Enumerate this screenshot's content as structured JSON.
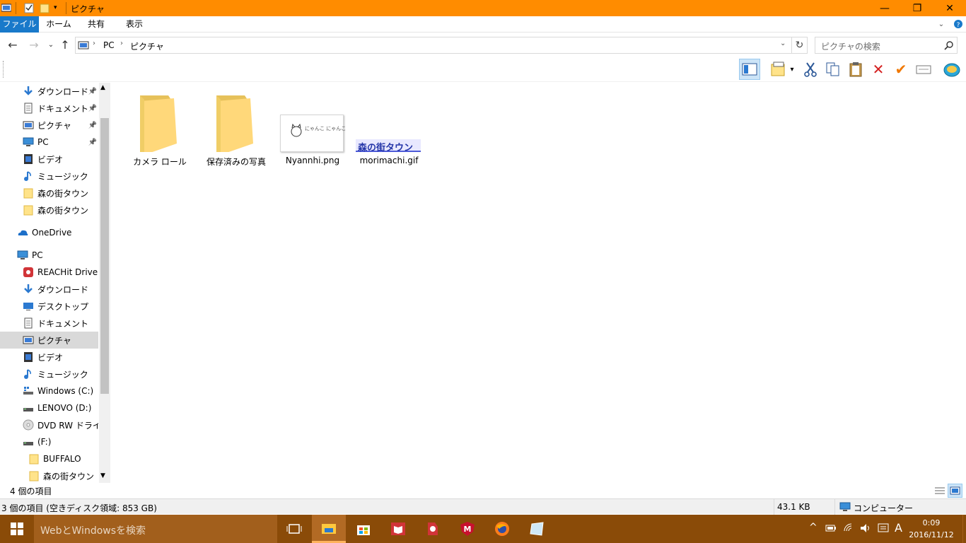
{
  "window": {
    "title": "ピクチャ"
  },
  "ribbon": {
    "tabs": [
      "ファイル",
      "ホーム",
      "共有",
      "表示"
    ]
  },
  "address": {
    "crumbs": [
      "PC",
      "ピクチャ"
    ],
    "search_placeholder": "ピクチャの検索"
  },
  "sidebar": {
    "quick_access": [
      {
        "label": "ダウンロード",
        "icon": "download-icon",
        "pinned": true
      },
      {
        "label": "ドキュメント",
        "icon": "document-icon",
        "pinned": true
      },
      {
        "label": "ピクチャ",
        "icon": "pictures-icon",
        "pinned": true
      },
      {
        "label": "PC",
        "icon": "pc-icon",
        "pinned": true
      },
      {
        "label": "ビデオ",
        "icon": "video-icon",
        "pinned": false
      },
      {
        "label": "ミュージック",
        "icon": "music-icon",
        "pinned": false
      },
      {
        "label": "森の街タウン",
        "icon": "folder-icon",
        "pinned": false
      },
      {
        "label": "森の街タウン",
        "icon": "folder-icon",
        "pinned": false
      }
    ],
    "onedrive": "OneDrive",
    "pc": "PC",
    "pc_items": [
      {
        "label": "REACHit Drive",
        "icon": "reachit-icon"
      },
      {
        "label": "ダウンロード",
        "icon": "download-icon"
      },
      {
        "label": "デスクトップ",
        "icon": "desktop-icon"
      },
      {
        "label": "ドキュメント",
        "icon": "document-icon"
      },
      {
        "label": "ピクチャ",
        "icon": "pictures-icon",
        "selected": true
      },
      {
        "label": "ビデオ",
        "icon": "video-icon"
      },
      {
        "label": "ミュージック",
        "icon": "music-icon"
      },
      {
        "label": "Windows (C:)",
        "icon": "windows-drive-icon"
      },
      {
        "label": "LENOVO (D:)",
        "icon": "drive-icon"
      },
      {
        "label": "DVD RW ドライブ (",
        "icon": "dvd-icon"
      },
      {
        "label": "(F:)",
        "icon": "drive-icon"
      },
      {
        "label": "BUFFALO",
        "icon": "folder-icon"
      },
      {
        "label": "森の街タウン",
        "icon": "folder-icon"
      }
    ]
  },
  "files": [
    {
      "name": "カメラ ロール",
      "type": "folder"
    },
    {
      "name": "保存済みの写真",
      "type": "folder"
    },
    {
      "name": "Nyannhi.png",
      "type": "image",
      "thumb_text": "にゃんこ にゃんこ"
    },
    {
      "name": "morimachi.gif",
      "type": "image",
      "thumb_text": "森の街タウン"
    }
  ],
  "status": {
    "item_count": "4 個の項目",
    "summary": "3 個の項目 (空きディスク領域: 853 GB)",
    "size": "43.1 KB",
    "location": "コンピューター"
  },
  "taskbar": {
    "search_placeholder": "WebとWindowsを検索",
    "ime": "A",
    "time": "0:09",
    "date": "2016/11/12"
  },
  "colors": {
    "titlebar": "#ff8c00",
    "file_tab": "#1979ca",
    "taskbar": "#8a4b08",
    "selection": "#d9d9d9"
  }
}
